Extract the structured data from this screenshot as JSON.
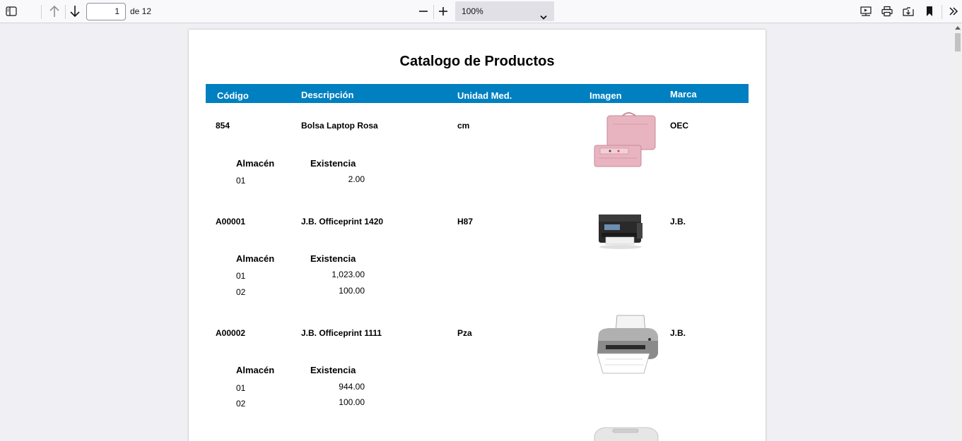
{
  "toolbar": {
    "page_number": "1",
    "page_total": "de 12",
    "zoom": "100%"
  },
  "document": {
    "title": "Catalogo de Productos",
    "headers": {
      "codigo": "Código",
      "descripcion": "Descripción",
      "unidad": "Unidad Med.",
      "imagen": "Imagen",
      "marca": "Marca"
    },
    "sub_headers": {
      "almacen": "Almacén",
      "existencia": "Existencia"
    },
    "products": [
      {
        "codigo": "854",
        "descripcion": "Bolsa Laptop Rosa",
        "unidad": "cm",
        "marca": "OEC",
        "image": "pink-laptop-bag",
        "stock": [
          {
            "almacen": "01",
            "existencia": "2.00"
          }
        ]
      },
      {
        "codigo": "A00001",
        "descripcion": "J.B. Officeprint 1420",
        "unidad": "H87",
        "marca": "J.B.",
        "image": "black-inkjet-printer",
        "stock": [
          {
            "almacen": "01",
            "existencia": "1,023.00"
          },
          {
            "almacen": "02",
            "existencia": "100.00"
          }
        ]
      },
      {
        "codigo": "A00002",
        "descripcion": "J.B. Officeprint 1111",
        "unidad": "Pza",
        "marca": "J.B.",
        "image": "grey-photo-printer",
        "stock": [
          {
            "almacen": "01",
            "existencia": "944.00"
          },
          {
            "almacen": "02",
            "existencia": "100.00"
          }
        ]
      }
    ]
  }
}
